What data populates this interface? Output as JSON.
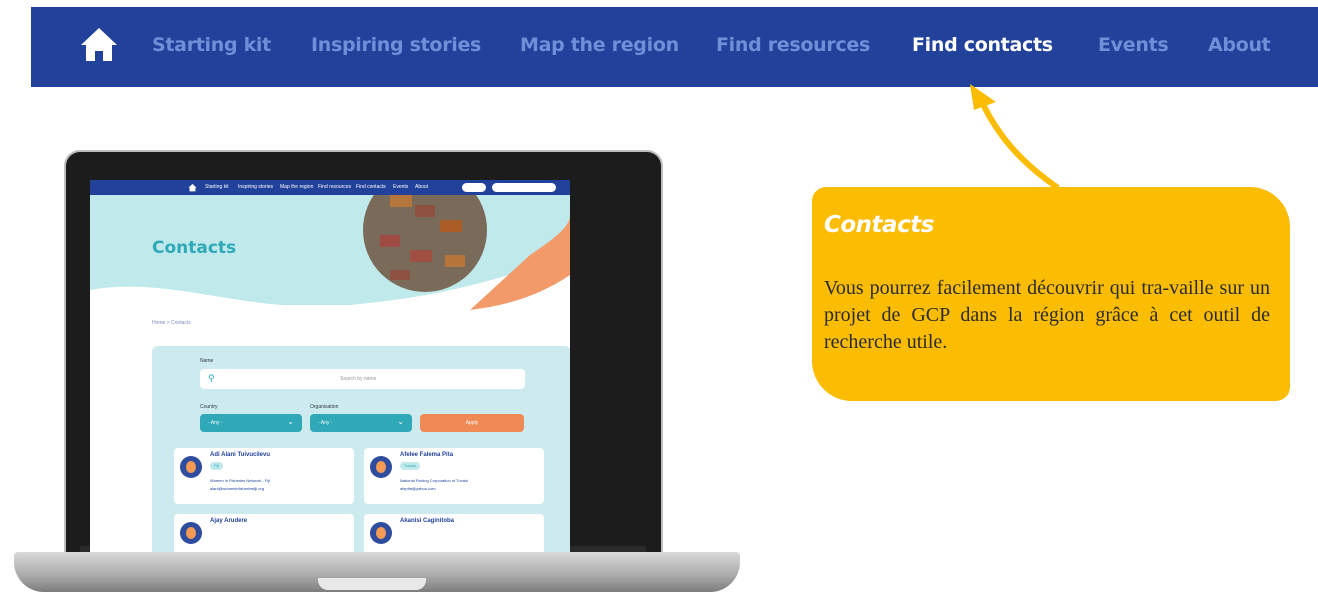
{
  "nav": {
    "items": [
      "Starting kit",
      "Inspiring stories",
      "Map the region",
      "Find resources",
      "Find contacts",
      "Events",
      "About"
    ],
    "active_index": 4
  },
  "callout": {
    "title": "Contacts",
    "text": "Vous pourrez facilement découvrir qui tra-vaille sur un projet de GCP dans la région grâce à cet outil de recherche utile."
  },
  "mini_site": {
    "nav": [
      "Starting kit",
      "Inspiring stories",
      "Map the region",
      "Find resources",
      "Find contacts",
      "Events",
      "About"
    ],
    "title": "Contacts",
    "breadcrumb": "Home > Contacts",
    "name_label": "Name",
    "search_placeholder": "Search by name",
    "country_label": "Country",
    "organisation_label": "Organisation",
    "select_any": "- Any -",
    "apply": "Apply",
    "cards": [
      {
        "name": "Adi Alani Tuivucilevu",
        "country": "Fiji",
        "org": "Women in Fisheries Network - Fiji",
        "email": "alani@womeninfisheriesfiji.org"
      },
      {
        "name": "Afelee Falema Pita",
        "country": "Tuvalu",
        "org": "National Fishing Corporation of Tuvalu",
        "email": "afepita@yahoo.com"
      },
      {
        "name": "Ajay Arudere",
        "country": "",
        "org": "",
        "email": ""
      },
      {
        "name": "Akanisi Caginitoba",
        "country": "",
        "org": "",
        "email": ""
      }
    ]
  },
  "colors": {
    "nav_bg": "#22419b",
    "callout_bg": "#fbbc04",
    "teal": "#2fa8b8",
    "orange": "#f08a55"
  }
}
